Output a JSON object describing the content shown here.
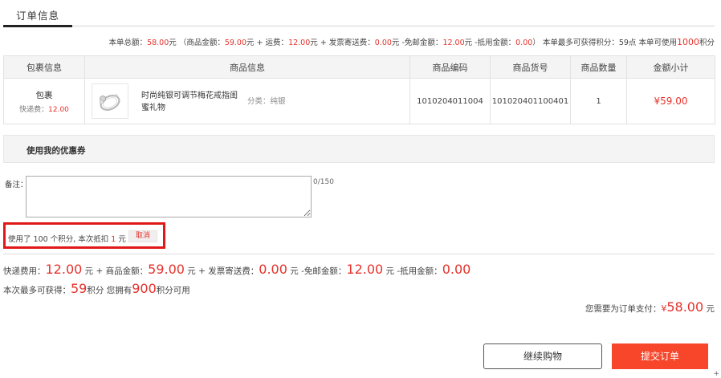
{
  "tab": {
    "label": "订单信息"
  },
  "summary": {
    "total_label": "本单总额：",
    "total_value": "58.00",
    "unit": "元",
    "goods_label": "（商品金额：",
    "goods_value": "59.00",
    "shipping_label": "+ 运费：",
    "shipping_value": "12.00",
    "invoice_label": "+ 发票寄送费：",
    "invoice_value": "0.00",
    "free_ship_label": "-免邮金额：",
    "free_ship_value": "12.00",
    "deduct_label": "-抵用金额：",
    "deduct_value": "0.00",
    "close_paren": "）",
    "points_label": "本单最多可获得积分：",
    "points_value": "59点",
    "usable_label": "本单可使用",
    "usable_value": "1000",
    "usable_unit": "积分"
  },
  "table": {
    "headers": [
      "包裹信息",
      "商品信息",
      "商品编码",
      "商品货号",
      "商品数量",
      "金额小计"
    ],
    "row": {
      "package_title": "包裹",
      "package_fee_label": "快递费：",
      "package_fee_value": "12.00",
      "goods_name": "时尚纯银可调节梅花戒指闺蜜礼物",
      "goods_spec": "分类：纯银",
      "code": "1010204011004",
      "item_no": "101020401100401",
      "quantity": "1",
      "subtotal": "¥59.00"
    }
  },
  "coupon": {
    "label": "使用我的优惠券"
  },
  "remark": {
    "label": "备注：",
    "value": "",
    "counter": "0/150"
  },
  "points_used": {
    "prefix": "使用了",
    "points": "100",
    "middle": "个积分, 本次抵扣",
    "amount": "1",
    "unit": "元",
    "cancel_label": "取消"
  },
  "fees": {
    "shipping_label": "快递费用：",
    "shipping_value": "12.00",
    "unit": "元",
    "goods_label": "+ 商品金额：",
    "goods_value": "59.00",
    "invoice_label": "+ 发票寄送费：",
    "invoice_value": "0.00",
    "free_label": "-免邮金额：",
    "free_value": "12.00",
    "deduct_label": "-抵用金额：",
    "deduct_value": "0.00"
  },
  "earn": {
    "label": "本次最多可获得：",
    "value": "59",
    "unit": "积分",
    "own_label": "您拥有",
    "own_value": "900",
    "own_suffix": "积分可用"
  },
  "pay": {
    "label": "您需要为订单支付：",
    "currency": "¥",
    "value": "58.00",
    "unit": "元"
  },
  "buttons": {
    "continue_label": "继续购物",
    "submit_label": "提交订单"
  },
  "corner_glyph": "+",
  "colors": {
    "accent_red": "#e6322b",
    "submit_bg": "#f7462a",
    "highlight_box": "#e01818"
  }
}
